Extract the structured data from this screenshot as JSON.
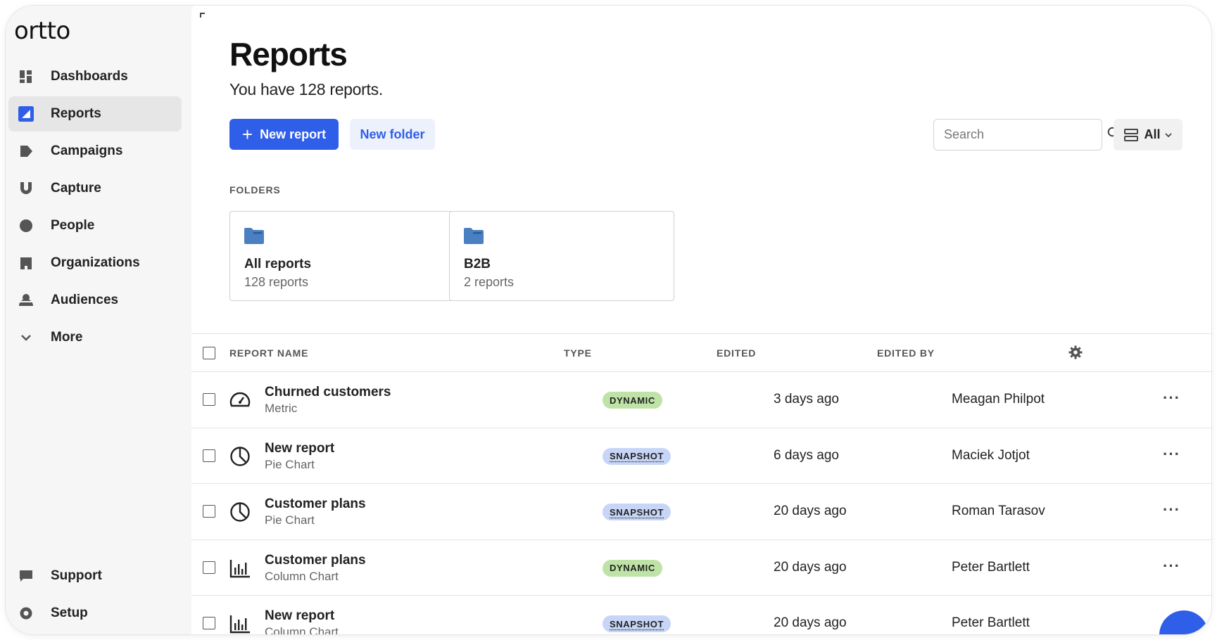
{
  "app": {
    "logo": "ortto"
  },
  "sidebar": {
    "items": [
      {
        "label": "Dashboards",
        "icon": "dashboard-icon",
        "active": false
      },
      {
        "label": "Reports",
        "icon": "reports-icon",
        "active": true
      },
      {
        "label": "Campaigns",
        "icon": "campaigns-icon",
        "active": false
      },
      {
        "label": "Capture",
        "icon": "capture-icon",
        "active": false
      },
      {
        "label": "People",
        "icon": "people-icon",
        "active": false
      },
      {
        "label": "Organizations",
        "icon": "organizations-icon",
        "active": false
      },
      {
        "label": "Audiences",
        "icon": "audiences-icon",
        "active": false
      },
      {
        "label": "More",
        "icon": "chevron-down-icon",
        "active": false
      }
    ],
    "bottom": [
      {
        "label": "Support",
        "icon": "support-icon"
      },
      {
        "label": "Setup",
        "icon": "setup-icon"
      }
    ]
  },
  "header": {
    "title": "Reports",
    "subtitle": "You have 128 reports.",
    "new_report_label": "New report",
    "new_folder_label": "New folder",
    "search_placeholder": "Search",
    "view_label": "All"
  },
  "folders": {
    "label": "FOLDERS",
    "items": [
      {
        "name": "All reports",
        "count": "128 reports"
      },
      {
        "name": "B2B",
        "count": "2 reports"
      }
    ]
  },
  "table": {
    "columns": {
      "name": "REPORT NAME",
      "type": "TYPE",
      "edited": "EDITED",
      "edited_by": "EDITED BY"
    },
    "rows": [
      {
        "name": "Churned customers",
        "subtype": "Metric",
        "icon": "gauge-icon",
        "type": "DYNAMIC",
        "edited": "3 days ago",
        "edited_by": "Meagan Philpot"
      },
      {
        "name": "New report",
        "subtype": "Pie Chart",
        "icon": "pie-chart-icon",
        "type": "SNAPSHOT",
        "edited": "6 days ago",
        "edited_by": "Maciek Jotjot"
      },
      {
        "name": "Customer plans",
        "subtype": "Pie Chart",
        "icon": "pie-chart-icon",
        "type": "SNAPSHOT",
        "edited": "20 days ago",
        "edited_by": "Roman Tarasov"
      },
      {
        "name": "Customer plans",
        "subtype": "Column Chart",
        "icon": "column-chart-icon",
        "type": "DYNAMIC",
        "edited": "20 days ago",
        "edited_by": "Peter Bartlett"
      },
      {
        "name": "New report",
        "subtype": "Column Chart",
        "icon": "column-chart-icon",
        "type": "SNAPSHOT",
        "edited": "20 days ago",
        "edited_by": "Peter Bartlett"
      }
    ]
  },
  "colors": {
    "accent": "#2f5ee8",
    "dynamic_badge": "#bfe3a6",
    "snapshot_badge": "#c7d6f7"
  }
}
